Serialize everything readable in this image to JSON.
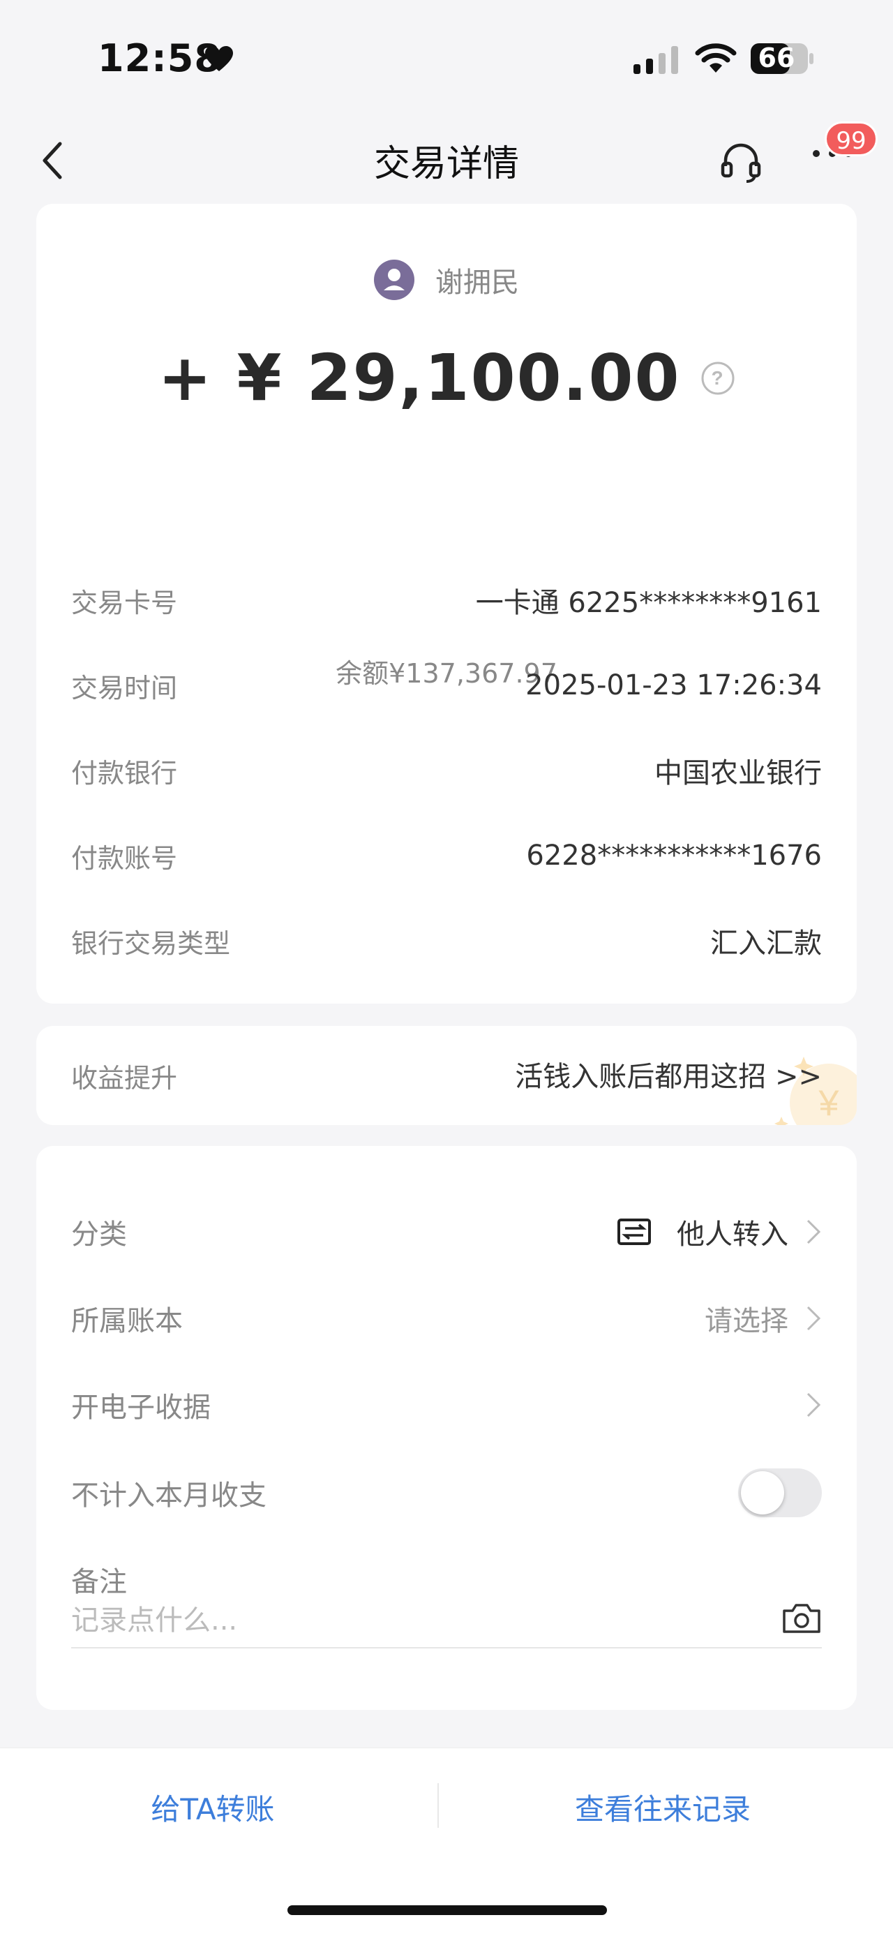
{
  "status_bar": {
    "time": "12:58",
    "battery": "66"
  },
  "nav": {
    "title": "交易详情",
    "badge": "99"
  },
  "transaction": {
    "payer_name": "谢拥民",
    "amount": "+ ¥ 29,100.00",
    "balance": "余额¥137,367.97",
    "details": [
      {
        "label": "交易卡号",
        "value": "一卡通 6225********9161"
      },
      {
        "label": "交易时间",
        "value": "2025-01-23 17:26:34"
      },
      {
        "label": "付款银行",
        "value": "中国农业银行"
      },
      {
        "label": "付款账号",
        "value": "6228***********1676"
      },
      {
        "label": "银行交易类型",
        "value": "汇入汇款"
      }
    ]
  },
  "promo": {
    "label": "收益提升",
    "link": "活钱入账后都用这招 >>"
  },
  "settings": {
    "category_label": "分类",
    "category_value": "他人转入",
    "ledger_label": "所属账本",
    "ledger_value": "请选择",
    "receipt_label": "开电子收据",
    "exclude_label": "不计入本月收支",
    "exclude_on": false,
    "remark_label": "备注",
    "remark_placeholder": "记录点什么..."
  },
  "bottom": {
    "transfer_label": "给TA转账",
    "history_label": "查看往来记录"
  },
  "colors": {
    "accent": "#3d7edb",
    "badge": "#f25c5c",
    "avatar": "#7a6d99"
  }
}
